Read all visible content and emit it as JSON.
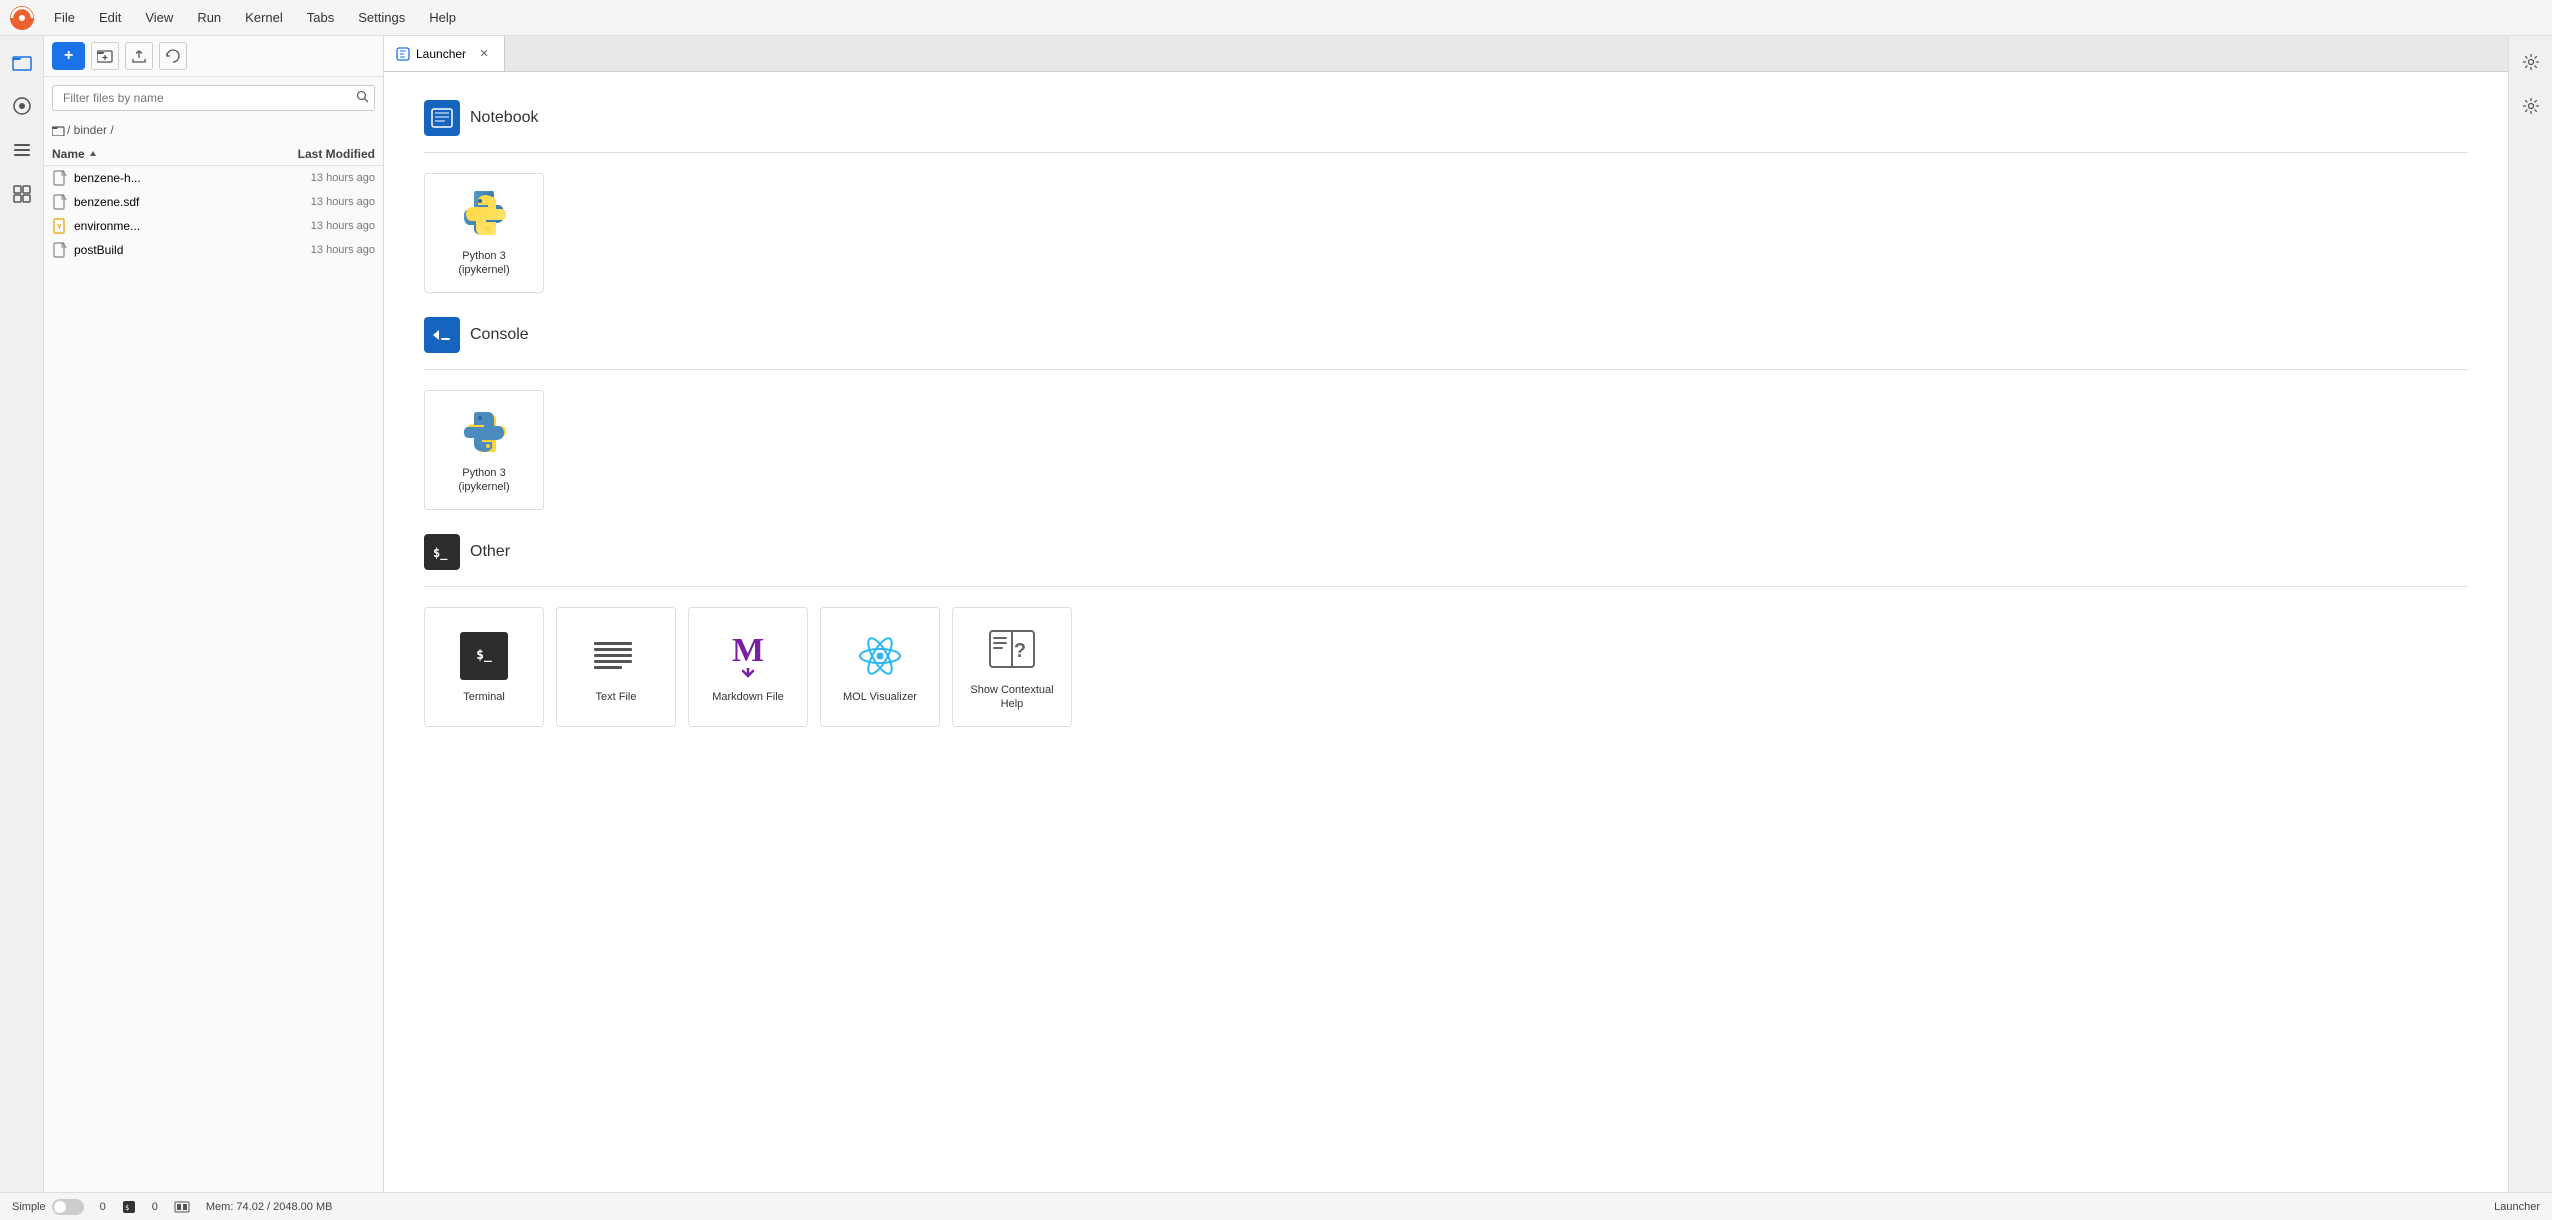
{
  "menubar": {
    "items": [
      "File",
      "Edit",
      "View",
      "Run",
      "Kernel",
      "Tabs",
      "Settings",
      "Help"
    ]
  },
  "activity_bar": {
    "icons": [
      {
        "name": "files-icon",
        "symbol": "📁"
      },
      {
        "name": "search-icon",
        "symbol": "🔍"
      },
      {
        "name": "git-icon",
        "symbol": "⎇"
      },
      {
        "name": "extensions-icon",
        "symbol": "🔌"
      }
    ]
  },
  "sidebar": {
    "toolbar": {
      "new_button": "+",
      "folder_icon_title": "New Folder",
      "upload_icon_title": "Upload",
      "refresh_icon_title": "Refresh"
    },
    "search_placeholder": "Filter files by name",
    "breadcrumb": "/ binder /",
    "columns": {
      "name": "Name",
      "modified": "Last Modified"
    },
    "files": [
      {
        "name": "benzene-h...",
        "modified": "13 hours ago",
        "type": "file"
      },
      {
        "name": "benzene.sdf",
        "modified": "13 hours ago",
        "type": "file"
      },
      {
        "name": "environme...",
        "modified": "13 hours ago",
        "type": "yaml"
      },
      {
        "name": "postBuild",
        "modified": "13 hours ago",
        "type": "file"
      }
    ]
  },
  "tabs": [
    {
      "label": "Launcher",
      "icon": "launcher-icon",
      "active": true,
      "closable": true
    }
  ],
  "launcher": {
    "sections": [
      {
        "id": "notebook",
        "icon_type": "notebook",
        "icon_symbol": "📓",
        "title": "Notebook",
        "cards": [
          {
            "label": "Python 3\n(ipykernel)",
            "icon_type": "python"
          }
        ]
      },
      {
        "id": "console",
        "icon_type": "console",
        "icon_symbol": ">_",
        "title": "Console",
        "cards": [
          {
            "label": "Python 3\n(ipykernel)",
            "icon_type": "python"
          }
        ]
      },
      {
        "id": "other",
        "icon_type": "other",
        "icon_symbol": "$_",
        "title": "Other",
        "cards": [
          {
            "label": "Terminal",
            "icon_type": "terminal"
          },
          {
            "label": "Text File",
            "icon_type": "textfile"
          },
          {
            "label": "Markdown File",
            "icon_type": "markdown"
          },
          {
            "label": "MOL Visualizer",
            "icon_type": "mol"
          },
          {
            "label": "Show Contextual\nHelp",
            "icon_type": "help"
          }
        ]
      }
    ]
  },
  "status_bar": {
    "mode": "Simple",
    "toggle_state": "off",
    "counter1": "0",
    "counter2": "0",
    "memory": "Mem: 74.02 / 2048.00 MB",
    "right_label": "Launcher"
  },
  "right_bar": {
    "icons": [
      {
        "name": "settings-icon",
        "symbol": "⚙"
      },
      {
        "name": "properties-icon",
        "symbol": "⚙"
      }
    ]
  }
}
